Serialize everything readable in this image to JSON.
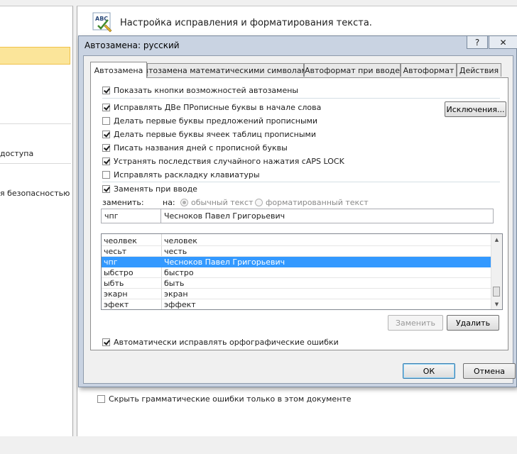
{
  "left_panel": {
    "item_access": "доступа",
    "item_security": "я безопасностью"
  },
  "header": {
    "icon": "abc-spellcheck-icon",
    "title": "Настройка исправления и форматирования текста."
  },
  "bottom": {
    "hide_grammar": "Скрыть грамматические ошибки только в этом документе"
  },
  "dialog": {
    "title": "Автозамена: русский",
    "help_button": "?",
    "close_button": "✕",
    "tabs": [
      "Автозамена",
      "Автозамена математическими символами",
      "Автоформат при вводе",
      "Автоформат",
      "Действия"
    ],
    "show_buttons": "Показать кнопки возможностей автозамены",
    "options": [
      "Исправлять ДВе ПРописные буквы в начале слова",
      "Делать первые буквы предложений прописными",
      "Делать первые буквы ячеек таблиц прописными",
      "Писать названия дней с прописной буквы",
      "Устранять последствия случайного нажатия cAPS LOCK",
      "Исправлять раскладку клавиатуры"
    ],
    "exceptions_button": "Исключения...",
    "replace_on_input": "Заменять при вводе",
    "replace_label": "заменить:",
    "with_label": "на:",
    "plain_text": "обычный текст",
    "formatted_text": "форматированный текст",
    "replace_value": "чпг",
    "with_value": "Чесноков Павел Григорьевич",
    "rows": [
      {
        "from": "чеолвек",
        "to": "человек"
      },
      {
        "from": "чесьт",
        "to": "честь"
      },
      {
        "from": "чпг",
        "to": "Чесноков Павел Григорьевич"
      },
      {
        "from": "ыбстро",
        "to": "быстро"
      },
      {
        "from": "ыбть",
        "to": "быть"
      },
      {
        "from": "экарн",
        "to": "экран"
      },
      {
        "from": "эфект",
        "to": "эффект"
      }
    ],
    "replace_button": "Заменить",
    "delete_button": "Удалить",
    "auto_spell": "Автоматически исправлять орфографические ошибки",
    "ok_button": "ОК",
    "cancel_button": "Отмена"
  },
  "colors": {
    "selection": "#3399ff",
    "left_selection": "#fbe59a",
    "dialog_frame": "#c9d3e2"
  }
}
